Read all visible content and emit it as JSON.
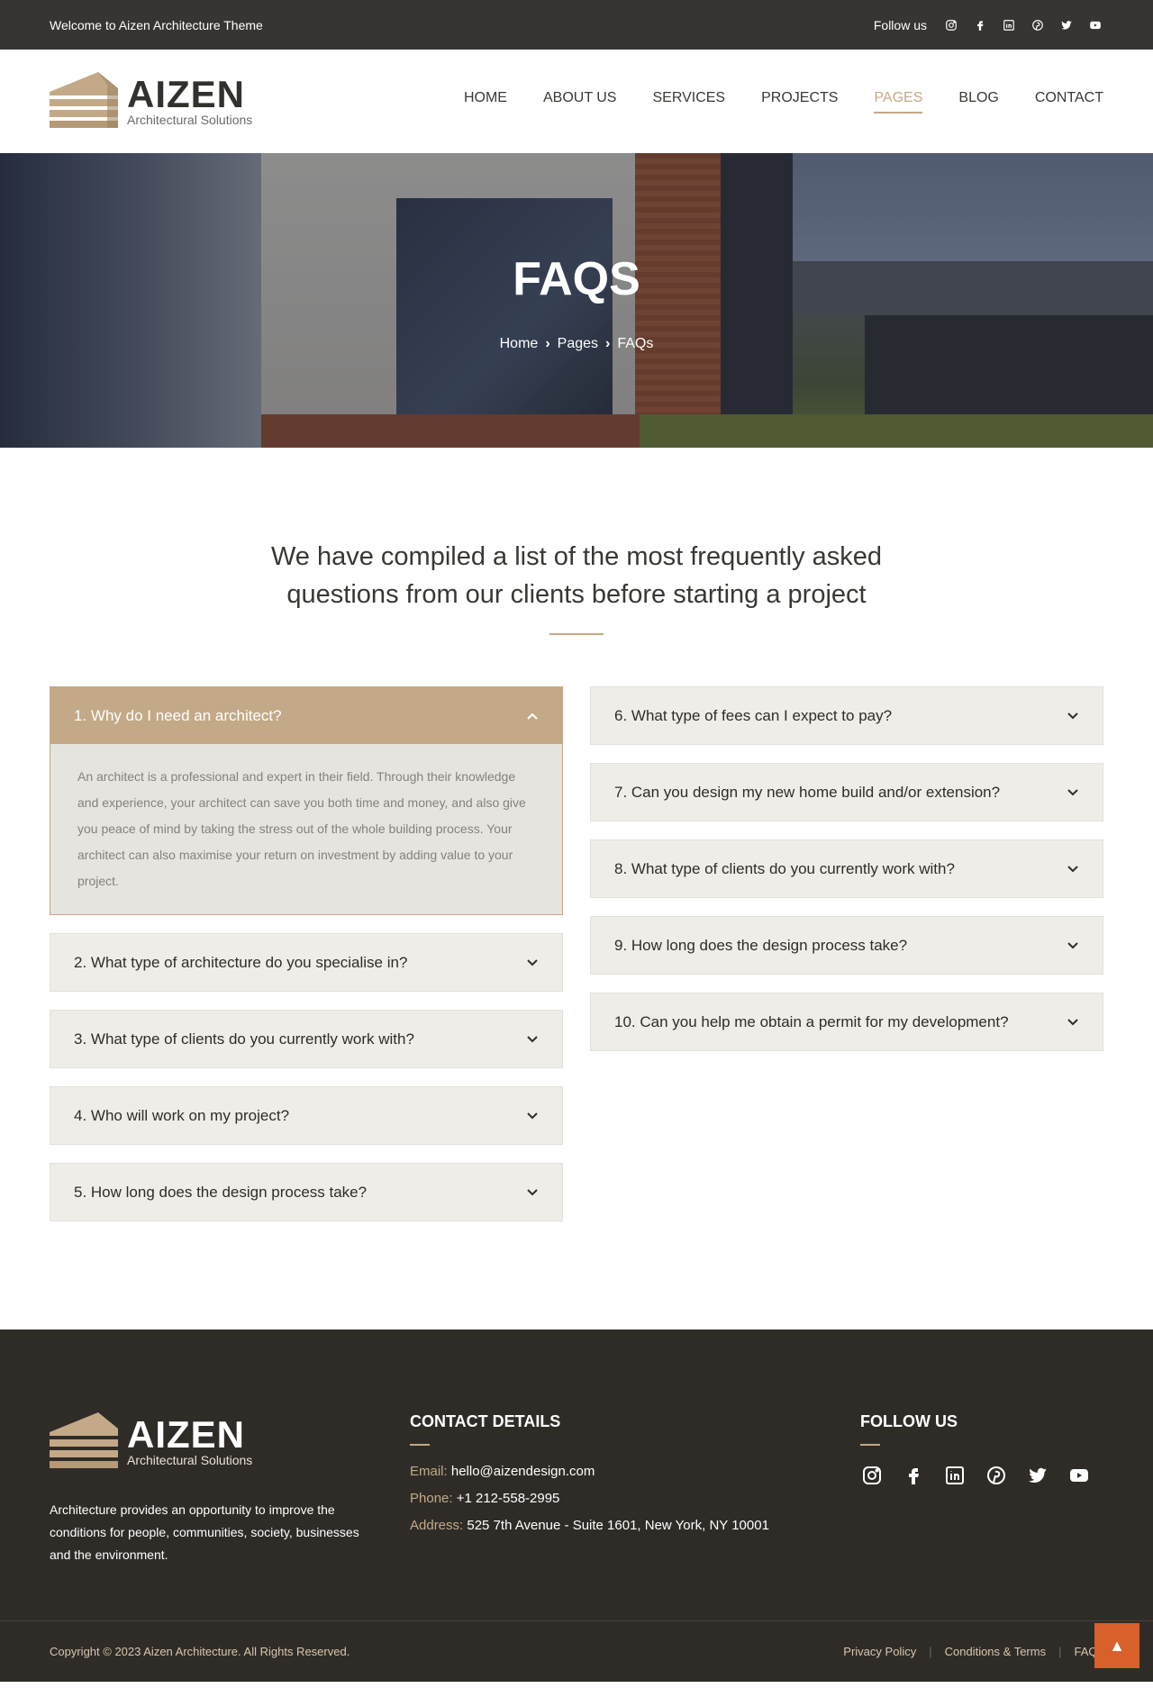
{
  "topbar": {
    "welcome": "Welcome to Aizen Architecture Theme",
    "follow_label": "Follow us",
    "icons": [
      "instagram-icon",
      "facebook-icon",
      "linkedin-icon",
      "pinterest-icon",
      "twitter-icon",
      "youtube-icon"
    ]
  },
  "brand": {
    "name": "AIZEN",
    "tagline": "Architectural Solutions",
    "accent": "#c3a987"
  },
  "nav": {
    "items": [
      "HOME",
      "ABOUT US",
      "SERVICES",
      "PROJECTS",
      "PAGES",
      "BLOG",
      "CONTACT"
    ],
    "active": "PAGES"
  },
  "hero": {
    "title": "FAQS",
    "crumbs": [
      "Home",
      "Pages",
      "FAQs"
    ]
  },
  "intro": {
    "heading": "We have compiled a list of the most frequently asked questions from our clients before starting a project"
  },
  "faq": {
    "left": [
      {
        "q": "1. Why do I need an architect?",
        "open": true,
        "a": "An architect is a professional and expert in their field. Through their knowledge and experience, your architect can save you both time and money, and also give you peace of mind by taking the stress out of the whole building process. Your architect can also maximise your return on investment by adding value to your project."
      },
      {
        "q": "2. What type of architecture do you specialise in?",
        "open": false
      },
      {
        "q": "3. What type of clients do you currently work with?",
        "open": false
      },
      {
        "q": "4. Who will work on my project?",
        "open": false
      },
      {
        "q": "5. How long does the design process take?",
        "open": false
      }
    ],
    "right": [
      {
        "q": "6. What type of fees can I expect to pay?",
        "open": false
      },
      {
        "q": "7. Can you design my new home build and/or extension?",
        "open": false
      },
      {
        "q": "8. What type of clients do you currently work with?",
        "open": false
      },
      {
        "q": "9. How long does the design process take?",
        "open": false
      },
      {
        "q": "10. Can you help me obtain a permit for my development?",
        "open": false
      }
    ]
  },
  "footer": {
    "description": "Architecture provides an opportunity to improve the conditions for people, communities, society, businesses and the environment.",
    "contact_heading": "CONTACT DETAILS",
    "email_label": "Email:",
    "email": "hello@aizendesign.com",
    "phone_label": "Phone:",
    "phone": "+1 212-558-2995",
    "address_label": "Address:",
    "address": "525 7th Avenue - Suite 1601, New York, NY 10001",
    "follow_heading": "FOLLOW US",
    "social_icons": [
      "instagram-icon",
      "facebook-icon",
      "linkedin-icon",
      "pinterest-icon",
      "twitter-icon",
      "youtube-icon"
    ],
    "copyright": "Copyright © 2023 Aizen Architecture. All Rights Reserved.",
    "links": [
      "Privacy Policy",
      "Conditions & Terms",
      "FAQs"
    ],
    "to_top_color": "#d8602a"
  }
}
